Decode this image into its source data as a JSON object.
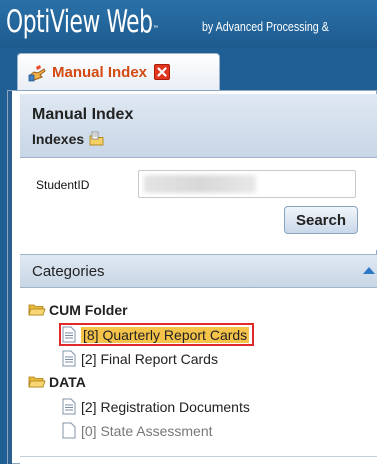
{
  "brand": {
    "name": "OptiView Web",
    "trademark": "™",
    "tagline": "by Advanced Processing &"
  },
  "tab": {
    "label": "Manual Index",
    "icon": "hand-index-icon",
    "close_icon": "close-icon"
  },
  "manual_index": {
    "title": "Manual Index",
    "subtitle": "Indexes",
    "subtitle_icon": "edit-folder-icon"
  },
  "form": {
    "student_id_label": "StudentID",
    "student_id_value": "",
    "search_label": "Search"
  },
  "categories": {
    "title": "Categories",
    "collapse_icon": "collapse-arrow-icon",
    "folders": [
      {
        "name": "CUM Folder",
        "items": [
          {
            "text": "[8] Quarterly Report Cards",
            "selected": true
          },
          {
            "text": "[2] Final Report Cards",
            "selected": false
          }
        ]
      },
      {
        "name": "DATA",
        "items": [
          {
            "text": "[2] Registration Documents",
            "selected": false
          },
          {
            "text": "[0] State Assessment",
            "selected": false,
            "empty": true
          }
        ]
      }
    ]
  },
  "colors": {
    "header_blue": "#1f5f93",
    "tab_label": "#d44a10",
    "selection_fill": "#f5c34a",
    "selection_outline": "#e02a2a",
    "arrow_blue": "#2b78c5"
  }
}
